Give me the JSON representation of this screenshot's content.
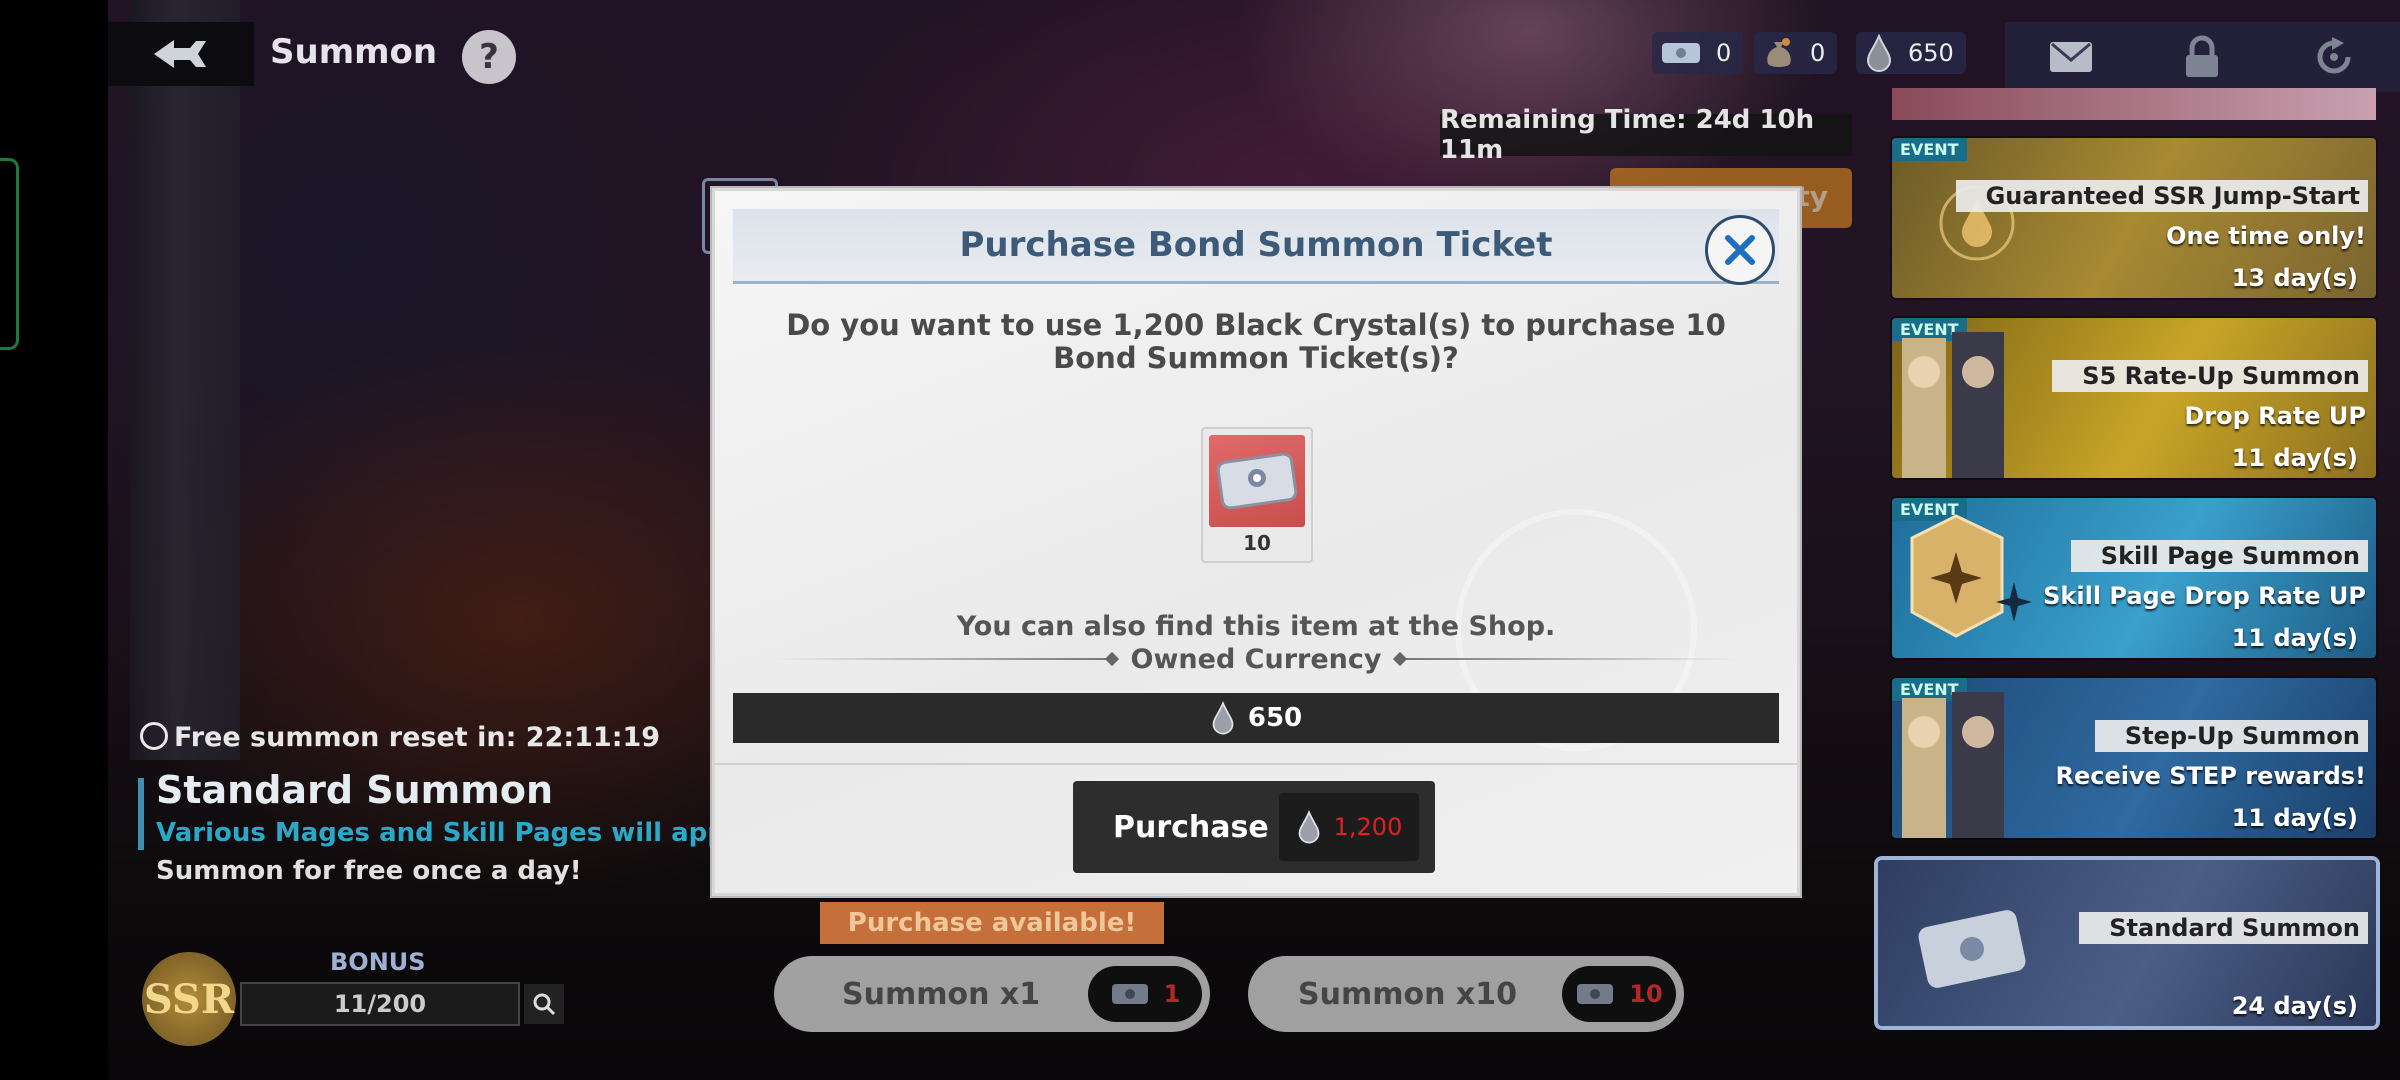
{
  "screen_title": "Summon",
  "help_label": "?",
  "currencies": [
    {
      "icon": "ticket-icon",
      "value": "0"
    },
    {
      "icon": "money-bag-icon",
      "value": "0"
    },
    {
      "icon": "black-crystal-icon",
      "value": "650"
    }
  ],
  "top_icons": [
    "mail-icon",
    "lock-icon",
    "refresh-icon"
  ],
  "remaining_time": "Remaining Time: 24d 10h 11m",
  "orange_button_label": "ty",
  "events": [
    {
      "tag": "EVENT",
      "title": "Guaranteed SSR Jump-Start",
      "subtitle": "One time only!",
      "days": "13 day(s)"
    },
    {
      "tag": "EVENT",
      "title": "S5 Rate-Up Summon",
      "subtitle": "Drop Rate UP",
      "days": "11 day(s)"
    },
    {
      "tag": "EVENT",
      "title": "Skill Page Summon",
      "subtitle": "Skill Page Drop Rate UP",
      "days": "11 day(s)"
    },
    {
      "tag": "EVENT",
      "title": "Step-Up Summon",
      "subtitle": "Receive STEP rewards!",
      "days": "11 day(s)"
    },
    {
      "tag": "",
      "title": "Standard Summon",
      "subtitle": "",
      "days": "24 day(s)"
    }
  ],
  "banner": {
    "free_reset": "Free summon reset in: 22:11:19",
    "title": "Standard Summon",
    "description": "Various Mages and Skill Pages will appea",
    "free_note": "Summon for free once a day!",
    "ssr_label": "SSR",
    "bonus_label": "BONUS",
    "bonus_progress": "11/200"
  },
  "summon": {
    "purchase_available": "Purchase available!",
    "x1_label": "Summon x1",
    "x1_cost": "1",
    "x10_label": "Summon x10",
    "x10_cost": "10"
  },
  "dialog": {
    "title": "Purchase Bond Summon Ticket",
    "question_line1": "Do you want to use 1,200 Black Crystal(s) to purchase 10",
    "question_line2": "Bond Summon Ticket(s)?",
    "item_count": "10",
    "shop_note": "You can also find this item at the Shop.",
    "owned_label": "Owned Currency",
    "owned_value": "650",
    "purchase_label": "Purchase",
    "purchase_cost": "1,200"
  },
  "colors": {
    "dialog_title": "#3d5a78",
    "cost_red": "#e02020",
    "event_tag": "#1a6d8a",
    "accent_orange": "#c5703a",
    "banner_desc": "#2aa8c8"
  }
}
